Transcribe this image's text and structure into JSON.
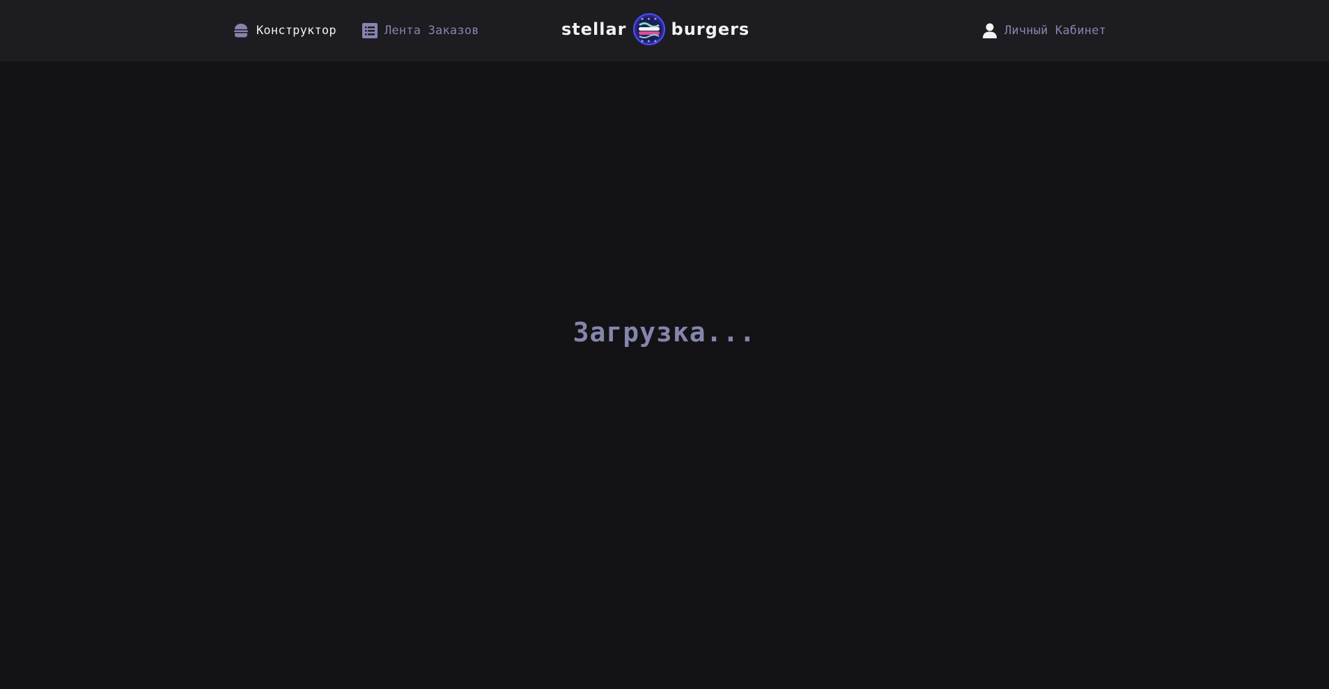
{
  "header": {
    "nav": {
      "constructor_label": "Конструктор",
      "feed_label": "Лента Заказов",
      "profile_label": "Личный Кабинет"
    },
    "logo": {
      "left_text": "stellar",
      "right_text": "burgers",
      "icon": "burger-planet-icon"
    }
  },
  "main": {
    "loading_text": "Загрузка..."
  },
  "colors": {
    "background": "#131316",
    "header_background": "#1c1c21",
    "active_text": "#f2f2f3",
    "inactive_text": "#8585ad"
  }
}
